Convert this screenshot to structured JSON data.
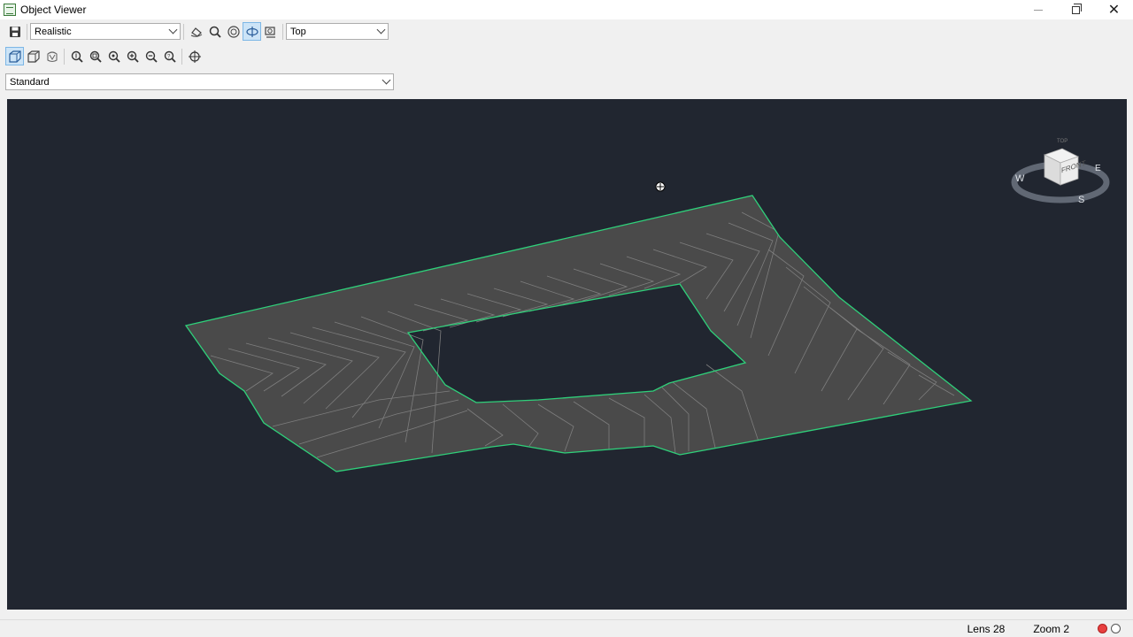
{
  "window": {
    "title": "Object Viewer"
  },
  "toolbar": {
    "visual_style": "Realistic",
    "view_direction": "Top",
    "named_view": "Standard"
  },
  "viewcube": {
    "face_label": "FRONT",
    "top_label": "TOP",
    "compass": {
      "west": "W",
      "east": "E",
      "south": "S"
    }
  },
  "status": {
    "lens": "Lens 28",
    "zoom": "Zoom 2"
  },
  "colors": {
    "viewport_bg": "#212630",
    "surface_fill": "#4a4a4a",
    "boundary": "#2fd07a",
    "contour": "#8a8a8a"
  },
  "icons": {
    "save": "save-icon",
    "orbit": "orbit-icon",
    "zoom": "zoom-icon",
    "target": "target-icon"
  }
}
